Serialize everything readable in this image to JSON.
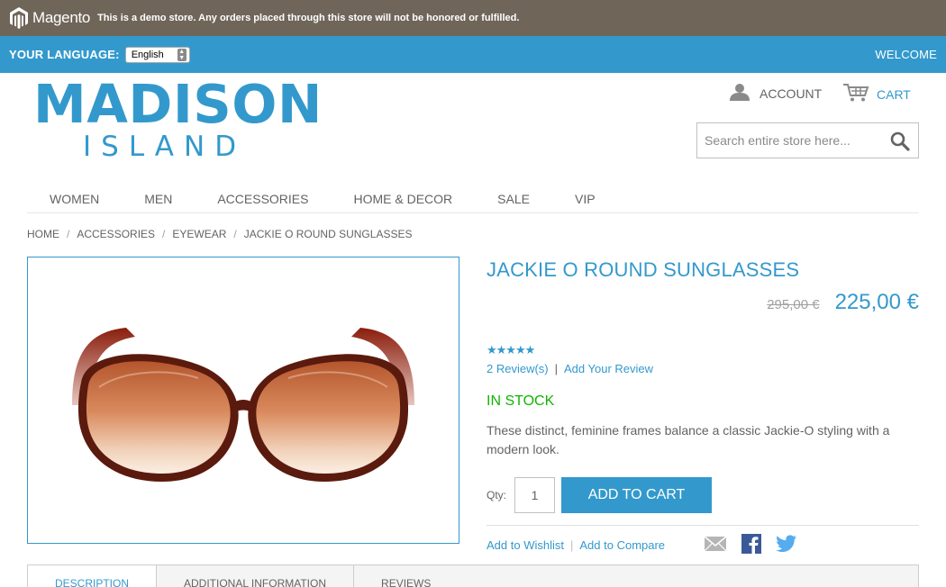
{
  "demo_bar": {
    "logo_text": "Magento",
    "notice": "This is a demo store. Any orders placed through this store will not be honored or fulfilled."
  },
  "language_bar": {
    "label": "YOUR LANGUAGE:",
    "selected_language": "English",
    "welcome": "WELCOME"
  },
  "logo": {
    "line1": "MADISON",
    "line2": "ISLAND"
  },
  "header_links": {
    "account": "ACCOUNT",
    "cart": "CART"
  },
  "search": {
    "placeholder": "Search entire store here..."
  },
  "nav": {
    "items": [
      "WOMEN",
      "MEN",
      "ACCESSORIES",
      "HOME & DECOR",
      "SALE",
      "VIP"
    ]
  },
  "breadcrumb": {
    "items": [
      "HOME",
      "ACCESSORIES",
      "EYEWEAR",
      "JACKIE O ROUND SUNGLASSES"
    ],
    "separator": "/"
  },
  "product": {
    "name": "JACKIE O ROUND SUNGLASSES",
    "old_price": "295,00 €",
    "special_price": "225,00 €",
    "rating_stars": "★★★★★",
    "rating_value": 5,
    "reviews_link": "2 Review(s)",
    "add_review_link": "Add Your Review",
    "review_separator": "|",
    "stock_status": "IN STOCK",
    "description": "These distinct, feminine frames balance a classic Jackie-O styling with a modern look.",
    "qty_label": "Qty:",
    "qty_value": "1",
    "add_to_cart": "ADD TO CART",
    "wishlist_link": "Add to Wishlist",
    "compare_link": "Add to Compare",
    "action_separator": "|"
  },
  "share": {
    "icons": [
      "email-icon",
      "facebook-icon",
      "twitter-icon"
    ]
  },
  "tabs": {
    "items": [
      "DESCRIPTION",
      "ADDITIONAL INFORMATION",
      "REVIEWS"
    ],
    "active": "DESCRIPTION"
  },
  "colors": {
    "brand_blue": "#3399cc",
    "demo_bar_bg": "#6f6659",
    "in_stock_green": "#11b400",
    "text_gray": "#636363"
  }
}
